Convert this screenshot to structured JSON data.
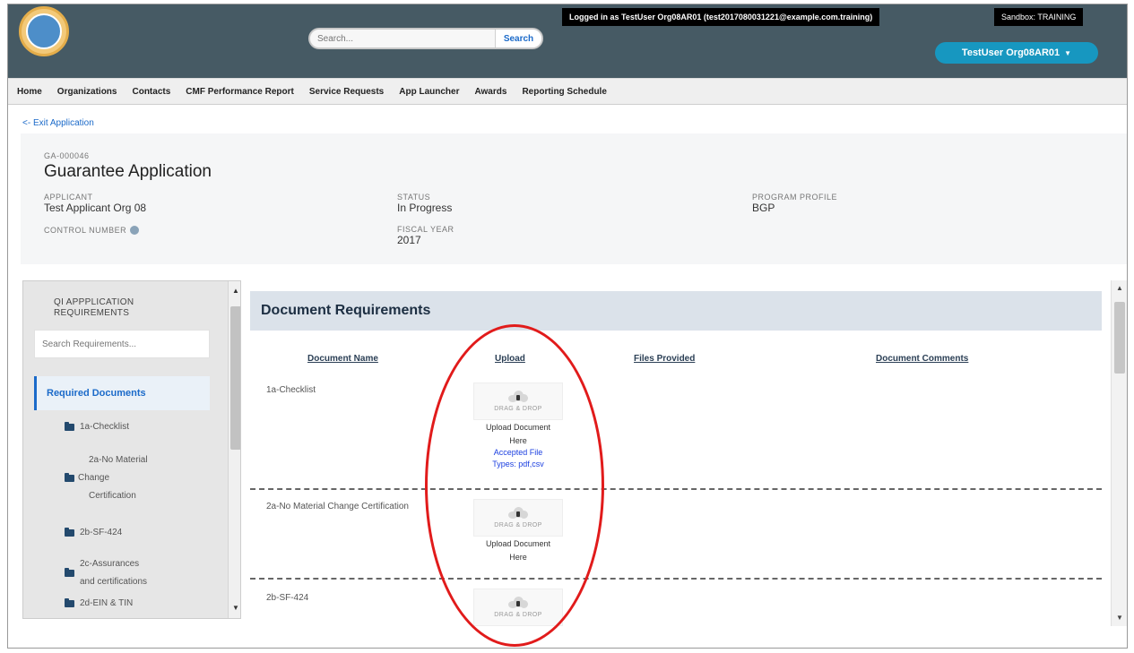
{
  "header": {
    "search_placeholder": "Search...",
    "search_button": "Search",
    "login_info": "Logged in as TestUser Org08AR01 (test2017080031221@example.com.training)",
    "sandbox_info": "Sandbox: TRAINING",
    "user_menu": "TestUser Org08AR01",
    "caret": "▼"
  },
  "nav": {
    "items": [
      "Home",
      "Organizations",
      "Contacts",
      "CMF Performance Report",
      "Service Requests",
      "App Launcher",
      "Awards",
      "Reporting Schedule"
    ]
  },
  "exit_link": "<- Exit Application",
  "record": {
    "id": "GA-000046",
    "title": "Guarantee Application",
    "applicant_label": "APPLICANT",
    "applicant_value": "Test Applicant Org 08",
    "control_label": "CONTROL NUMBER",
    "status_label": "STATUS",
    "status_value": "In Progress",
    "fiscal_label": "FISCAL YEAR",
    "fiscal_value": "2017",
    "profile_label": "PROGRAM PROFILE",
    "profile_value": "BGP"
  },
  "sidebar": {
    "title": "QI APPPLICATION REQUIREMENTS",
    "search_placeholder": "Search Requirements...",
    "selected": "Required Documents",
    "items": [
      {
        "lines": [
          "1a-Checklist"
        ]
      },
      {
        "lines": [
          "2a-No Material",
          "Change",
          "Certification"
        ]
      },
      {
        "lines": [
          "2b-SF-424"
        ]
      },
      {
        "lines": [
          "2c-Assurances",
          "and certifications"
        ]
      },
      {
        "lines": [
          "2d-EIN & TIN"
        ]
      }
    ],
    "scroll_up": "▲",
    "scroll_down": "▼"
  },
  "main": {
    "title": "Document Requirements",
    "columns": {
      "name": "Document Name",
      "upload": "Upload",
      "files": "Files Provided",
      "comments": "Document Comments"
    },
    "rows": [
      {
        "name": "1a-Checklist"
      },
      {
        "name": "2a-No Material Change Certification"
      },
      {
        "name": "2b-SF-424"
      }
    ],
    "dropzone_text": "DRAG & DROP",
    "upload_label_1": "Upload Document",
    "upload_label_2": "Here",
    "accepted_1": "Accepted File",
    "accepted_2": "Types: pdf,csv",
    "scroll_up": "▲",
    "scroll_down": "▼"
  },
  "colors": {
    "topbar": "#465a64",
    "accent": "#1b6ac9",
    "user_menu": "#1797c0",
    "highlight": "#e11b1b"
  }
}
